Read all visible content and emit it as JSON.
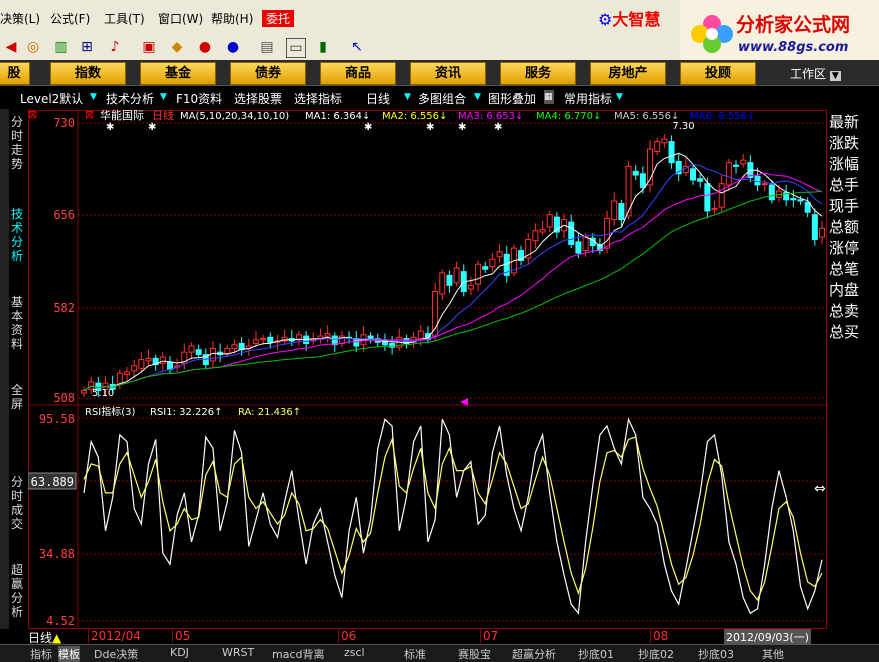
{
  "menu": {
    "items": [
      "决策(L)",
      "公式(F)",
      "工具(T)",
      "窗口(W)",
      "帮助(H)"
    ],
    "wt_label": "委托",
    "brand_left": "大智慧",
    "brand_right": "分析家公式网",
    "brand_url": "www.88gs.com"
  },
  "categories": [
    "股",
    "指数",
    "基金",
    "债券",
    "商品",
    "资讯",
    "服务",
    "房地产",
    "投顾"
  ],
  "workzone": "工作区",
  "toolbar2": [
    "Level2默认",
    "技术分析",
    "F10资料",
    "选择股票",
    "选择指标",
    "日线",
    "多图组合",
    "图形叠加",
    "常用指标"
  ],
  "left_tabs": [
    "分时走势",
    "技术分析",
    "基本资料",
    "全屏",
    "分时成交",
    "超赢分析"
  ],
  "right_list": [
    "最新",
    "涨跌",
    "涨幅",
    "总手",
    "现手",
    "总额",
    "涨停",
    "总笔",
    "内盘",
    "总卖",
    "总买"
  ],
  "price_panel": {
    "stock": "华能国际",
    "period": "日线",
    "ma_params": "MA(5,10,20,34,10,10)",
    "ma": [
      {
        "label": "MA1: 6.364↓",
        "color": "#ffffff"
      },
      {
        "label": "MA2: 6.556↓",
        "color": "#ffff00"
      },
      {
        "label": "MA3: 6.653↓",
        "color": "#ff00ff"
      },
      {
        "label": "MA4: 6.770↓",
        "color": "#00ff00"
      },
      {
        "label": "MA5: 6.556↓",
        "color": "#cccccc"
      },
      {
        "label": "MA6: 6.556↓",
        "color": "#0000ff"
      }
    ],
    "y_labels": [
      "730",
      "656",
      "582",
      "508"
    ],
    "hi_label": "7.30",
    "lo_label": "5.10"
  },
  "rsi_panel": {
    "title": "RSI指标(3)",
    "rsi1": "RSI1: 32.226↑",
    "ra": "RA: 21.436↑",
    "y_labels": [
      "95.58",
      "63.889",
      "34.88",
      "4.52"
    ]
  },
  "time_axis": {
    "period_label": "日线",
    "ticks": [
      "2012/04",
      "05",
      "06",
      "07",
      "08"
    ],
    "current_date": "2012/09/03(一)"
  },
  "bottom_tabs": [
    "指标",
    "模板",
    "Dde决策",
    "KDJ",
    "WRST",
    "macd背离",
    "zscl",
    "标准",
    "赛股宝",
    "超赢分析",
    "抄底01",
    "抄底02",
    "抄底03",
    "其他"
  ],
  "colors": {
    "up": "#ff3030",
    "down": "#30ffff",
    "grid": "#800000",
    "accent": "#ff0000"
  },
  "chart_data": {
    "type": "candlestick",
    "count": 104,
    "ylim": [
      5.08,
      7.3
    ],
    "close": [
      5.14,
      5.21,
      5.14,
      5.2,
      5.15,
      5.28,
      5.29,
      5.34,
      5.39,
      5.4,
      5.35,
      5.41,
      5.31,
      5.34,
      5.45,
      5.5,
      5.43,
      5.35,
      5.48,
      5.43,
      5.48,
      5.51,
      5.47,
      5.5,
      5.55,
      5.56,
      5.53,
      5.54,
      5.57,
      5.54,
      5.59,
      5.52,
      5.56,
      5.58,
      5.6,
      5.51,
      5.58,
      5.56,
      5.5,
      5.59,
      5.55,
      5.53,
      5.51,
      5.49,
      5.57,
      5.52,
      5.57,
      5.62,
      5.55,
      5.94,
      6.09,
      5.99,
      6.13,
      5.94,
      5.99,
      6.16,
      6.12,
      6.2,
      6.26,
      6.07,
      6.29,
      6.19,
      6.36,
      6.43,
      6.44,
      6.56,
      6.42,
      6.52,
      6.32,
      6.25,
      6.38,
      6.31,
      6.27,
      6.53,
      6.67,
      6.52,
      6.95,
      6.88,
      6.78,
      7.09,
      7.15,
      7.17,
      6.98,
      6.89,
      6.95,
      6.84,
      6.83,
      6.59,
      6.61,
      6.81,
      6.98,
      6.95,
      7.0,
      6.86,
      6.8,
      6.81,
      6.68,
      6.75,
      6.68,
      6.68,
      6.67,
      6.58,
      6.36,
      6.45
    ],
    "open": [
      5.12,
      5.15,
      5.2,
      5.15,
      5.19,
      5.19,
      5.27,
      5.3,
      5.32,
      5.38,
      5.4,
      5.36,
      5.37,
      5.33,
      5.36,
      5.45,
      5.47,
      5.43,
      5.38,
      5.45,
      5.44,
      5.48,
      5.52,
      5.48,
      5.52,
      5.55,
      5.57,
      5.53,
      5.54,
      5.56,
      5.55,
      5.58,
      5.54,
      5.56,
      5.58,
      5.58,
      5.52,
      5.57,
      5.56,
      5.51,
      5.58,
      5.56,
      5.55,
      5.52,
      5.49,
      5.56,
      5.53,
      5.56,
      5.6,
      5.58,
      5.92,
      6.07,
      6.01,
      6.1,
      5.96,
      6.0,
      6.14,
      6.14,
      6.22,
      6.24,
      6.09,
      6.27,
      6.21,
      6.35,
      6.42,
      6.46,
      6.54,
      6.43,
      6.5,
      6.34,
      6.27,
      6.37,
      6.32,
      6.29,
      6.52,
      6.65,
      6.55,
      6.91,
      6.89,
      6.8,
      7.07,
      7.14,
      7.15,
      6.99,
      6.9,
      6.93,
      6.85,
      6.81,
      6.6,
      6.62,
      6.8,
      6.96,
      6.97,
      6.98,
      6.87,
      6.81,
      6.8,
      6.7,
      6.74,
      6.69,
      6.68,
      6.66,
      6.56,
      6.38
    ],
    "ma_lines": {
      "MA1": "white",
      "MA2": "yellow",
      "MA3": "magenta",
      "MA4": "green"
    },
    "rsi_ylim": [
      4.52,
      95.58
    ],
    "rsi1": [
      62,
      85,
      78,
      45,
      60,
      88,
      85,
      55,
      48,
      75,
      86,
      35,
      30,
      52,
      62,
      40,
      52,
      87,
      82,
      45,
      58,
      90,
      80,
      38,
      50,
      62,
      48,
      42,
      58,
      72,
      50,
      30,
      48,
      55,
      40,
      25,
      15,
      45,
      60,
      35,
      50,
      82,
      95,
      92,
      45,
      60,
      85,
      92,
      40,
      50,
      95,
      88,
      60,
      72,
      76,
      48,
      52,
      80,
      92,
      70,
      55,
      45,
      60,
      80,
      88,
      62,
      40,
      25,
      12,
      8,
      40,
      65,
      88,
      92,
      82,
      75,
      95,
      88,
      60,
      55,
      48,
      30,
      18,
      12,
      28,
      45,
      62,
      85,
      88,
      70,
      40,
      30,
      15,
      8,
      10,
      30,
      55,
      72,
      60,
      45,
      20,
      10,
      18,
      32
    ],
    "rsi2": [
      68,
      75,
      74,
      62,
      62,
      75,
      80,
      70,
      60,
      67,
      77,
      58,
      45,
      48,
      55,
      50,
      51,
      70,
      76,
      62,
      60,
      75,
      78,
      60,
      55,
      58,
      53,
      48,
      52,
      62,
      57,
      45,
      46,
      50,
      46,
      36,
      26,
      34,
      46,
      40,
      44,
      62,
      78,
      86,
      65,
      62,
      73,
      82,
      62,
      55,
      75,
      82,
      72,
      72,
      74,
      62,
      57,
      68,
      80,
      75,
      65,
      55,
      57,
      68,
      78,
      70,
      55,
      40,
      26,
      17,
      28,
      46,
      67,
      80,
      81,
      78,
      86,
      87,
      73,
      64,
      56,
      43,
      30,
      21,
      24,
      34,
      48,
      66,
      77,
      74,
      57,
      43,
      29,
      18,
      14,
      22,
      38,
      55,
      58,
      51,
      35,
      22,
      20,
      26
    ]
  }
}
